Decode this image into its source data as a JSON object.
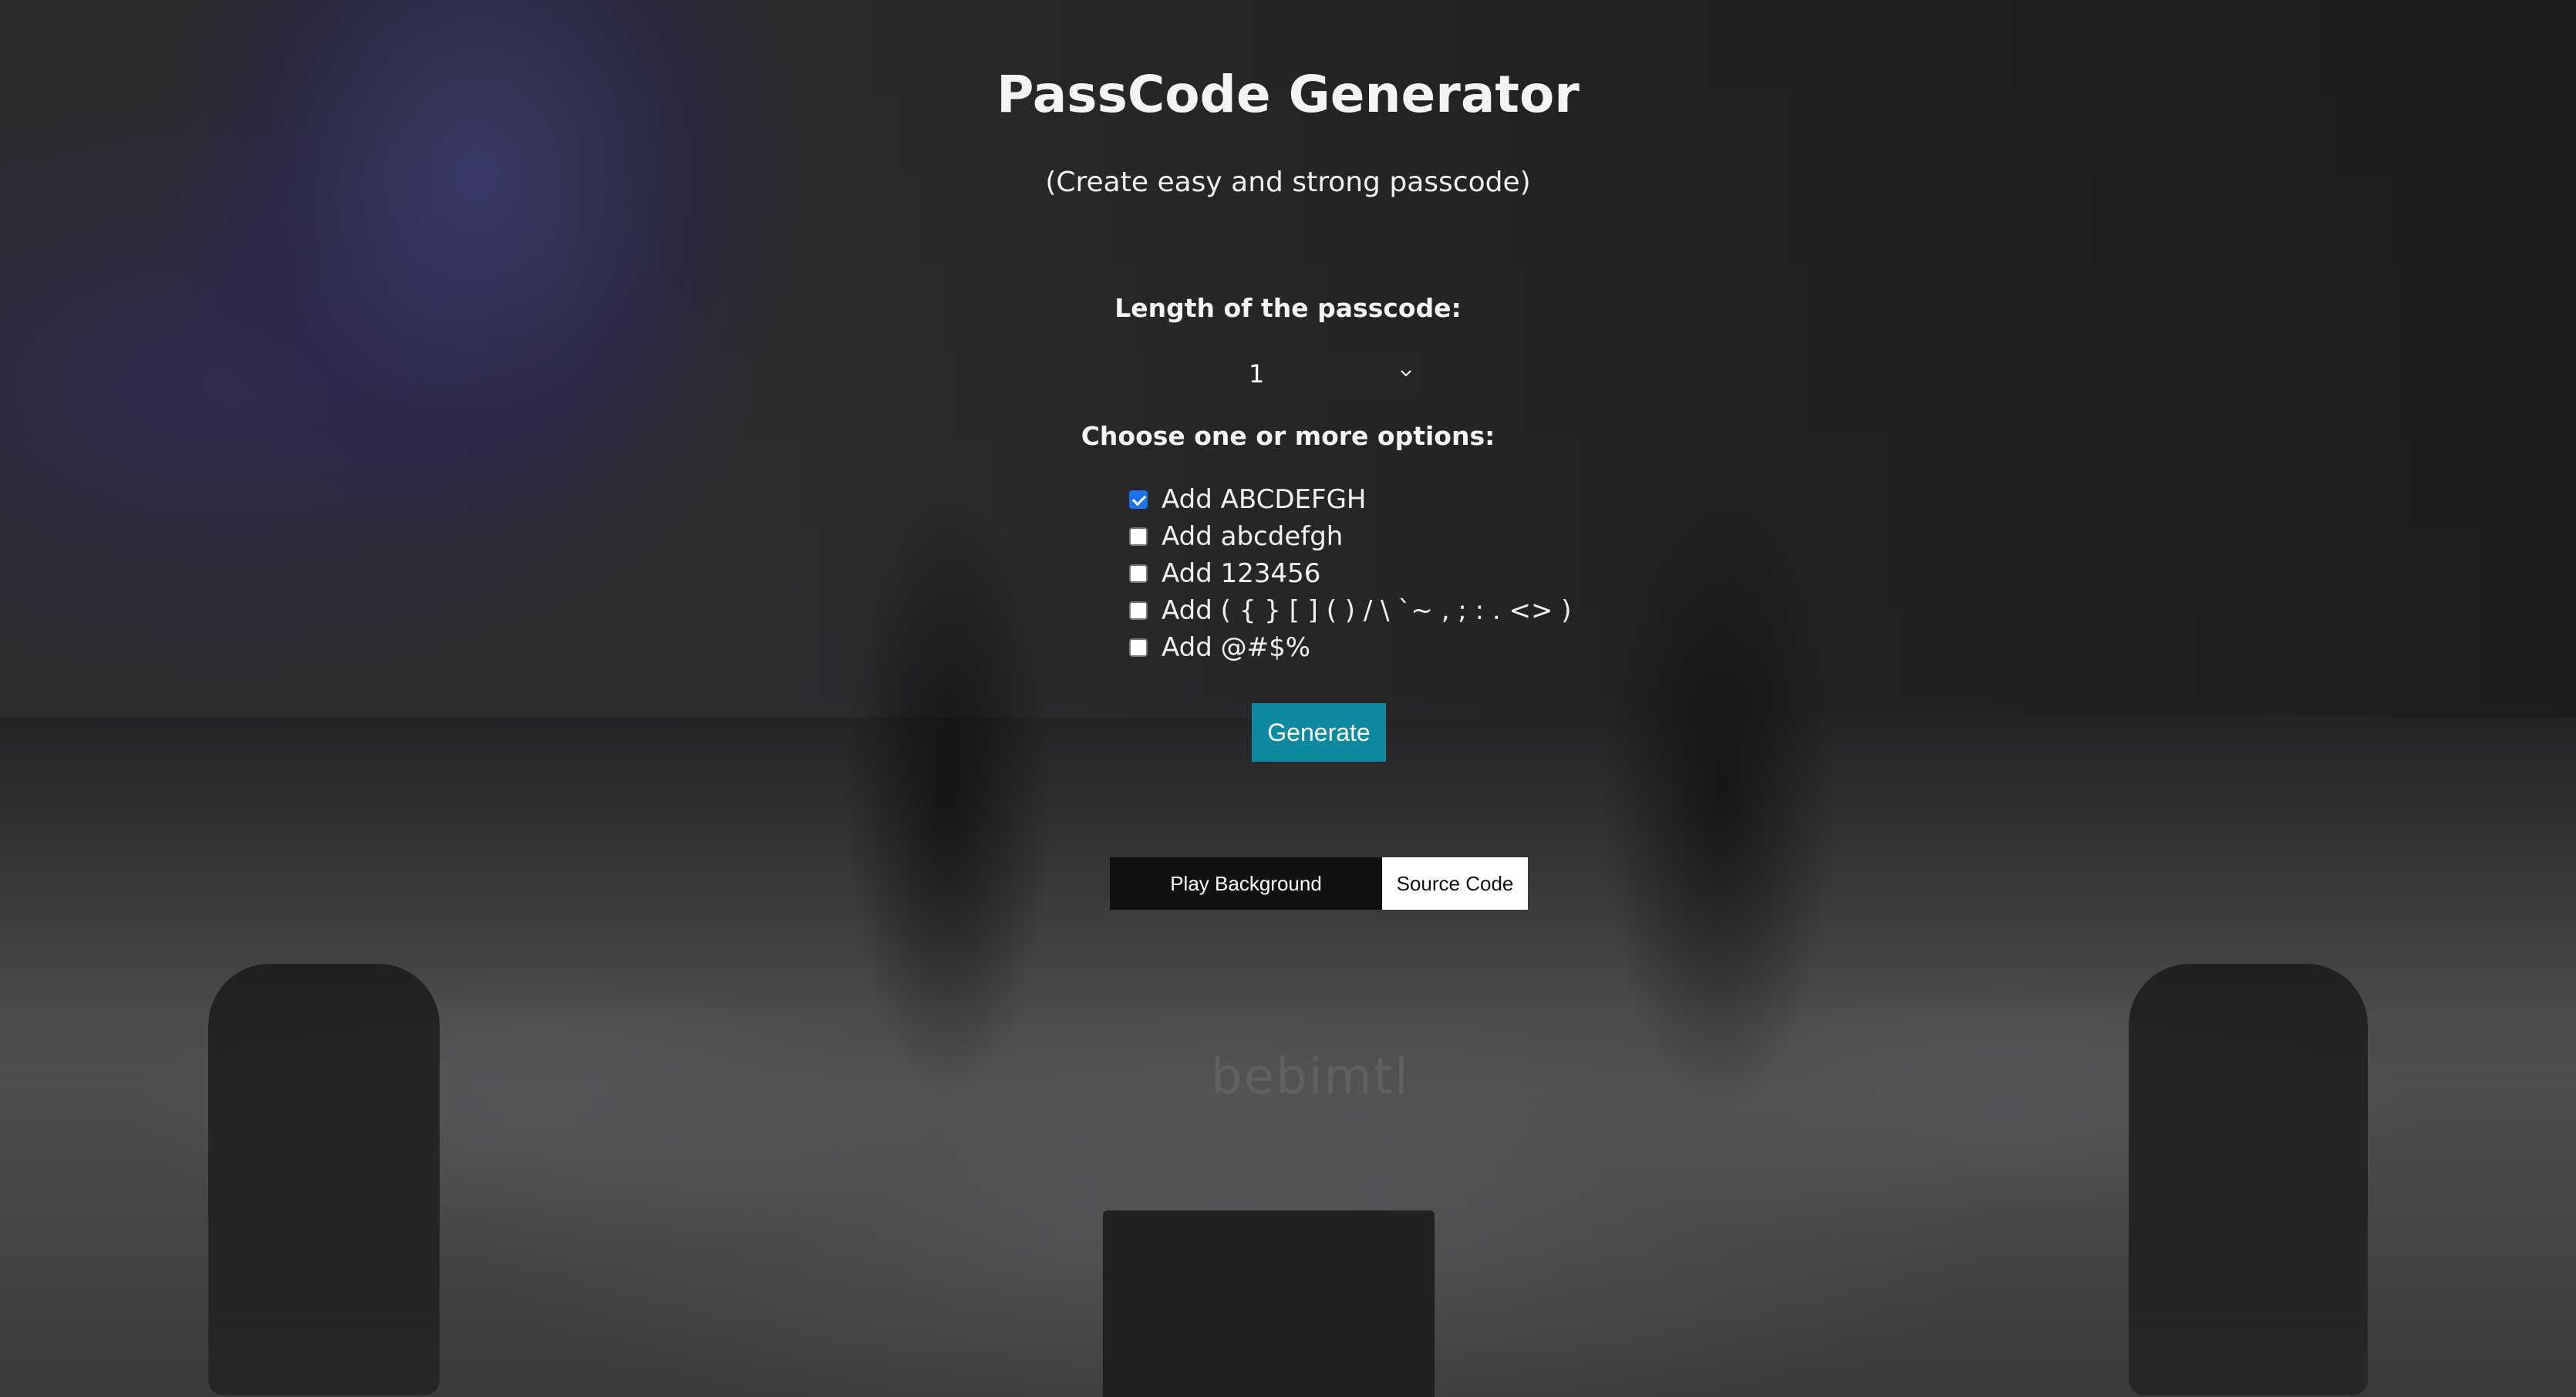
{
  "header": {
    "title": "PassCode Generator",
    "subtitle": "(Create easy and strong passcode)"
  },
  "length": {
    "label": "Length of the passcode:",
    "selected_value": "1"
  },
  "options": {
    "label": "Choose one or more options:",
    "items": [
      {
        "label": "Add ABCDEFGH",
        "checked": true
      },
      {
        "label": "Add abcdefgh",
        "checked": false
      },
      {
        "label": "Add 123456",
        "checked": false
      },
      {
        "label": "Add ( { } [ ] ( ) / \\ `~ , ; : . <> )",
        "checked": false
      },
      {
        "label": "Add @#$%",
        "checked": false
      }
    ]
  },
  "actions": {
    "generate_label": "Generate",
    "play_background_label": "Play Background",
    "source_code_label": "Source Code"
  },
  "background": {
    "watermark": "bebimtl"
  },
  "colors": {
    "accent": "#0e8aa0",
    "checkbox_checked": "#1a73e8",
    "select_bg": "#262626"
  }
}
